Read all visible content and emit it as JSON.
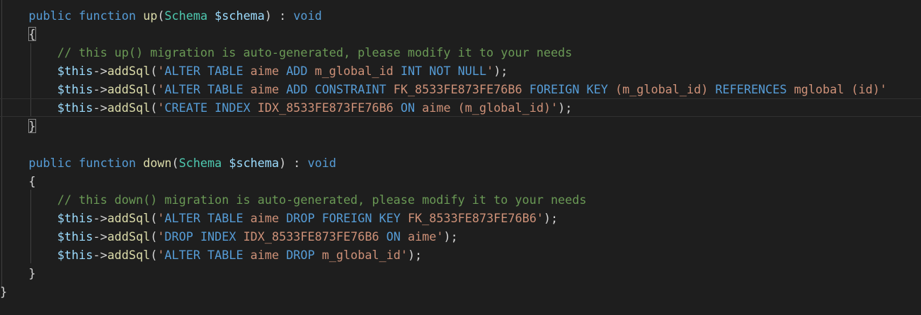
{
  "code": {
    "up_sig": {
      "kw_public": "public",
      "kw_function": "function",
      "name": "up",
      "paren_open": "(",
      "type": "Schema",
      "param": "$schema",
      "paren_close": ")",
      "colon": " : ",
      "ret": "void"
    },
    "up_open_brace": "{",
    "up_comment": "// this up() migration is auto-generated, please modify it to your needs",
    "up_lines": [
      {
        "var": "$this",
        "arrow": "->",
        "fn": "addSql",
        "paren_open": "(",
        "parts": [
          {
            "t": "'",
            "c": "str"
          },
          {
            "t": "ALTER TABLE",
            "c": "sqlkw"
          },
          {
            "t": " aime ",
            "c": "str"
          },
          {
            "t": "ADD",
            "c": "sqlkw"
          },
          {
            "t": " m_global_id ",
            "c": "str"
          },
          {
            "t": "INT NOT NULL",
            "c": "sqlkw"
          },
          {
            "t": "'",
            "c": "str"
          }
        ],
        "tail": ");"
      },
      {
        "var": "$this",
        "arrow": "->",
        "fn": "addSql",
        "paren_open": "(",
        "parts": [
          {
            "t": "'",
            "c": "str"
          },
          {
            "t": "ALTER TABLE",
            "c": "sqlkw"
          },
          {
            "t": " aime ",
            "c": "str"
          },
          {
            "t": "ADD CONSTRAINT",
            "c": "sqlkw"
          },
          {
            "t": " FK_8533FE873FE76B6 ",
            "c": "str"
          },
          {
            "t": "FOREIGN KEY",
            "c": "sqlkw"
          },
          {
            "t": " (m_global_id) ",
            "c": "str"
          },
          {
            "t": "REFERENCES",
            "c": "sqlkw"
          },
          {
            "t": " mglobal (id)'",
            "c": "str"
          }
        ],
        "tail": ""
      },
      {
        "var": "$this",
        "arrow": "->",
        "fn": "addSql",
        "paren_open": "(",
        "parts": [
          {
            "t": "'",
            "c": "str"
          },
          {
            "t": "CREATE INDEX",
            "c": "sqlkw"
          },
          {
            "t": " IDX_8533FE873FE76B6 ",
            "c": "str"
          },
          {
            "t": "ON",
            "c": "sqlkw"
          },
          {
            "t": " aime (m_global_id)'",
            "c": "str"
          }
        ],
        "tail": ");"
      }
    ],
    "up_close_brace": "}",
    "down_sig": {
      "kw_public": "public",
      "kw_function": "function",
      "name": "down",
      "paren_open": "(",
      "type": "Schema",
      "param": "$schema",
      "paren_close": ")",
      "colon": " : ",
      "ret": "void"
    },
    "down_open_brace": "{",
    "down_comment": "// this down() migration is auto-generated, please modify it to your needs",
    "down_lines": [
      {
        "var": "$this",
        "arrow": "->",
        "fn": "addSql",
        "paren_open": "(",
        "parts": [
          {
            "t": "'",
            "c": "str"
          },
          {
            "t": "ALTER TABLE",
            "c": "sqlkw"
          },
          {
            "t": " aime ",
            "c": "str"
          },
          {
            "t": "DROP FOREIGN KEY",
            "c": "sqlkw"
          },
          {
            "t": " FK_8533FE873FE76B6'",
            "c": "str"
          }
        ],
        "tail": ");"
      },
      {
        "var": "$this",
        "arrow": "->",
        "fn": "addSql",
        "paren_open": "(",
        "parts": [
          {
            "t": "'",
            "c": "str"
          },
          {
            "t": "DROP INDEX",
            "c": "sqlkw"
          },
          {
            "t": " IDX_8533FE873FE76B6 ",
            "c": "str"
          },
          {
            "t": "ON",
            "c": "sqlkw"
          },
          {
            "t": " aime'",
            "c": "str"
          }
        ],
        "tail": ");"
      },
      {
        "var": "$this",
        "arrow": "->",
        "fn": "addSql",
        "paren_open": "(",
        "parts": [
          {
            "t": "'",
            "c": "str"
          },
          {
            "t": "ALTER TABLE",
            "c": "sqlkw"
          },
          {
            "t": " aime ",
            "c": "str"
          },
          {
            "t": "DROP",
            "c": "sqlkw"
          },
          {
            "t": " m_global_id'",
            "c": "str"
          }
        ],
        "tail": ");"
      }
    ],
    "down_close_brace": "}",
    "class_close_brace": "}"
  },
  "colors": {
    "background": "#1e1e1e",
    "keyword": "#569cd6",
    "type": "#4ec9b0",
    "variable": "#9cdcfe",
    "function": "#dcdcaa",
    "string": "#ce9178",
    "comment": "#6a9955",
    "punctuation": "#d4d4d4"
  }
}
